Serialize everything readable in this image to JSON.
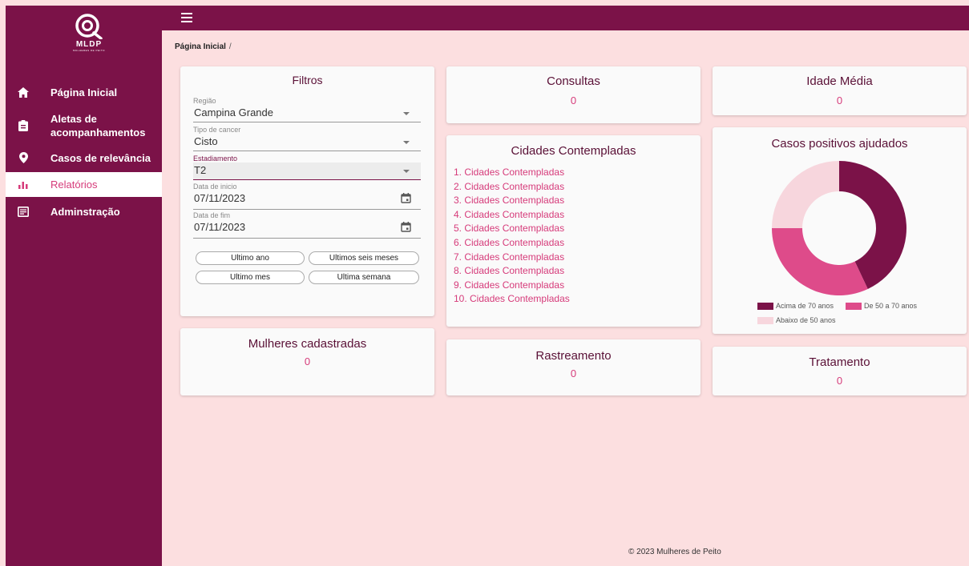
{
  "brand": {
    "name": "MLDP",
    "tagline": "MULHERES DE PEITO"
  },
  "sidebar": {
    "items": [
      {
        "label": "Página Inicial",
        "icon": "home-icon"
      },
      {
        "label": "Aletas de acompanhamentos",
        "icon": "clipboard-icon"
      },
      {
        "label": "Casos de relevância",
        "icon": "location-pin-icon"
      },
      {
        "label": "Relatórios",
        "icon": "bar-chart-icon",
        "active": true
      },
      {
        "label": "Adminstração",
        "icon": "admin-panel-icon"
      }
    ]
  },
  "topbar": {
    "menu_icon": "hamburger-icon"
  },
  "breadcrumb": {
    "current": "Página Inicial",
    "separator": "/"
  },
  "filters": {
    "title": "Filtros",
    "region": {
      "label": "Região",
      "value": "Campina Grande"
    },
    "cancer_type": {
      "label": "Tipo de cancer",
      "value": "Cisto"
    },
    "staging": {
      "label": "Estadiamento",
      "value": "T2"
    },
    "start_date": {
      "label": "Data de inicio",
      "value": "07/11/2023"
    },
    "end_date": {
      "label": "Data de fim",
      "value": "07/11/2023"
    },
    "quick": {
      "last_year": "Ultimo ano",
      "last_six_months": "Ultimos seis meses",
      "last_month": "Ultimo mes",
      "last_week": "Ultima semana"
    }
  },
  "stats": {
    "consultas": {
      "title": "Consultas",
      "value": "0"
    },
    "idade_media": {
      "title": "Idade Média",
      "value": "0"
    },
    "mulheres": {
      "title": "Mulheres cadastradas",
      "value": "0"
    },
    "rastreamento": {
      "title": "Rastreamento",
      "value": "0"
    },
    "tratamento": {
      "title": "Tratamento",
      "value": "0"
    }
  },
  "cities": {
    "title": "Cidades Contempladas",
    "items": [
      "1. Cidades Contempladas",
      "2. Cidades Contempladas",
      "3. Cidades Contempladas",
      "4. Cidades Contempladas",
      "5. Cidades Contempladas",
      "6. Cidades Contempladas",
      "7. Cidades Contempladas",
      "8. Cidades Contempladas",
      "9. Cidades Contempladas",
      "10. Cidades Contempladas"
    ]
  },
  "chart_data": {
    "type": "pie",
    "title": "Casos positivos ajudados",
    "legend_position": "bottom",
    "series": [
      {
        "name": "Acima de 70 anos",
        "value": 43,
        "color": "#7b1248"
      },
      {
        "name": "De 50 a 70 anos",
        "value": 32,
        "color": "#de4b8a"
      },
      {
        "name": "Abaixo de 50 anos",
        "value": 25,
        "color": "#f7d6dd"
      }
    ]
  },
  "footer": {
    "text": "© 2023 Mulheres de Peito"
  },
  "colors": {
    "brand": "#7b1248",
    "accent": "#d63b7a",
    "background": "#fcdfe0"
  }
}
